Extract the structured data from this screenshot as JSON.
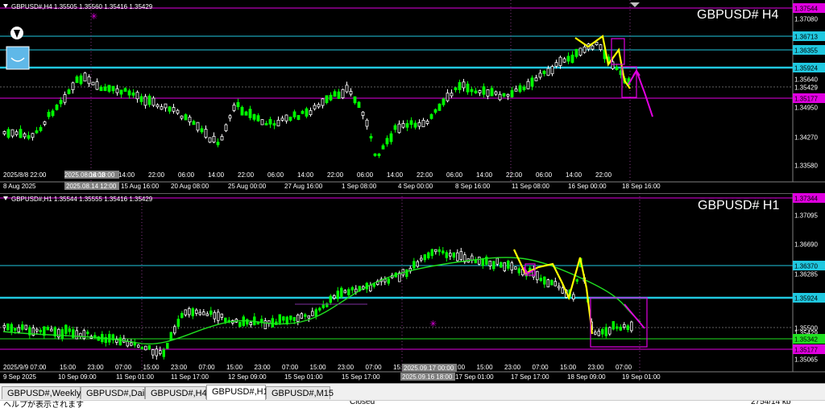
{
  "chartA": {
    "info": "GBPUSD#,H4  1.35505 1.35560 1.35416 1.35429",
    "title": "GBPUSD# H4",
    "price_levels": [
      {
        "label": "1.37544",
        "color": "#e000e0"
      },
      {
        "label": "1.37080",
        "color": "#ffffff"
      },
      {
        "label": "1.36713",
        "color": "#20c8e0"
      },
      {
        "label": "1.36355",
        "color": "#20c8e0"
      },
      {
        "label": "1.35924",
        "color": "#20c8e0"
      },
      {
        "label": "1.35640",
        "color": "#ffffff"
      },
      {
        "label": "1.35429",
        "color": "#ffffff"
      },
      {
        "label": "1.35177",
        "color": "#e000e0"
      },
      {
        "label": "1.34950",
        "color": "#ffffff"
      },
      {
        "label": "1.34270",
        "color": "#ffffff"
      },
      {
        "label": "1.33580",
        "color": "#ffffff"
      }
    ],
    "time_labels": [
      "8 Aug 2025",
      "12 Aug",
      "14 Aug",
      "15 Aug 16:00",
      "20 Aug 08:00",
      "25 Aug 00:00",
      "27 Aug 16:00",
      "1 Sep 08:00",
      "4 Sep 00:00",
      "8 Sep 16:00",
      "11 Sep 08:00",
      "16 Sep 00:00",
      "18 Sep 16:00"
    ],
    "time_labels_top": [
      "2025/8/8 22:00",
      "2025.08.14 18:00",
      "06:00",
      "14:00",
      "22:00",
      "06:00",
      "14:00",
      "22:00",
      "06:00",
      "14:00",
      "22:00",
      "06:00",
      "14:00",
      "22:00",
      "06:00",
      "14:00",
      "22:00",
      "06:00",
      "14:00",
      "22:00"
    ],
    "crosshair_label": "2025.08.14 12:00"
  },
  "chartB": {
    "info": "GBPUSD#,H1  1.35544 1.35555 1.35416 1.35429",
    "title": "GBPUSD# H1",
    "price_levels": [
      {
        "label": "1.37344",
        "color": "#e000e0"
      },
      {
        "label": "1.37095",
        "color": "#ffffff"
      },
      {
        "label": "1.36690",
        "color": "#ffffff"
      },
      {
        "label": "1.36370",
        "color": "#20c8e0"
      },
      {
        "label": "1.36285",
        "color": "#ffffff"
      },
      {
        "label": "1.35924",
        "color": "#20c8e0"
      },
      {
        "label": "1.35500",
        "color": "#ffffff"
      },
      {
        "label": "1.35429",
        "color": "#ffffff"
      },
      {
        "label": "1.35342",
        "color": "#20e020"
      },
      {
        "label": "1.35177",
        "color": "#e000e0"
      },
      {
        "label": "1.35065",
        "color": "#ffffff"
      }
    ],
    "time_labels": [
      "9 Sep 2025",
      "10 Sep 09:00",
      "11 Sep 01:00",
      "11 Sep 17:00",
      "12 Sep 09:00",
      "15 Sep 01:00",
      "15 Sep 17:00",
      "2025.09.16 18:00",
      "17 Sep 01:00",
      "17 Sep 17:00",
      "18 Sep 09:00",
      "19 Sep 01:00"
    ],
    "time_labels_top": [
      "2025/9/9 07:00",
      "15:00",
      "23:00",
      "07:00",
      "15:00",
      "23:00",
      "07:00",
      "15:00",
      "23:00",
      "07:00",
      "15:00",
      "23:00",
      "07:00",
      "15:00",
      "23:00",
      "07:00",
      "15:00",
      "23:00",
      "07:00",
      "15:00",
      "23:00",
      "07:00"
    ],
    "crosshair_label": "2025.09.17 00:00"
  },
  "tabs": [
    {
      "label": "GBPUSD#,Weekly"
    },
    {
      "label": "GBPUSD#,Daily"
    },
    {
      "label": "GBPUSD#,H4"
    },
    {
      "label": "GBPUSD#,H1",
      "active": true
    },
    {
      "label": "GBPUSD#,M15"
    }
  ],
  "status": {
    "left": "ヘルプが表示されます",
    "middle": "Closed",
    "right": "2754/14 kb"
  },
  "colors": {
    "bull": "#ffffff",
    "bear": "#00ff00",
    "cyan": "#20c8e0",
    "magenta": "#e000e0",
    "yellow": "#ffff00"
  }
}
